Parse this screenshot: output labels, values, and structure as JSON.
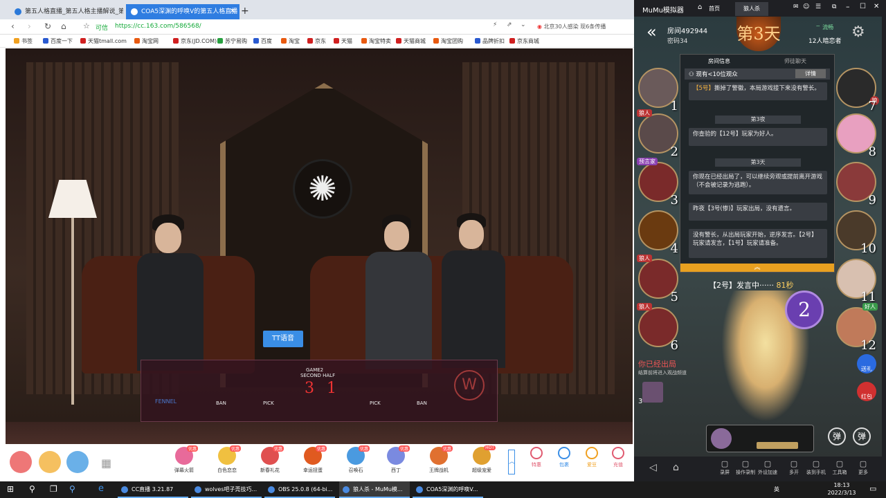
{
  "browser": {
    "tabs": [
      {
        "label": "第五人格直播_第五人格主播解说_第三"
      },
      {
        "label": "COA5深渊的呼唤V的第五人格直播"
      }
    ],
    "address": {
      "label": "可信",
      "url": "https://cc.163.com/586568/"
    },
    "search": "北京30人感染 现6条传播",
    "bookmarks": [
      "书签",
      "百度一下",
      "天猫tmall.com",
      "淘宝网",
      "京东(JD.COM)",
      "苏宁易购",
      "百度",
      "淘宝",
      "京东",
      "天猫",
      "淘宝特卖",
      "天猫商城",
      "淘宝团购",
      "品牌折扣",
      "京东商城"
    ]
  },
  "video": {
    "scoreboard": {
      "game": "GAME2",
      "half": "SECOND HALF",
      "score_left": "3",
      "score_right": "1",
      "ban_left": "BAN",
      "pick_left": "PICK",
      "pick_right": "PICK",
      "ban_right": "BAN",
      "team_left": "FENNEL"
    },
    "sponsor": "TT语音"
  },
  "giftbar": {
    "gifts": [
      {
        "label": "弹幕火箭",
        "badge": "优惠"
      },
      {
        "label": "白色恋恋",
        "badge": "优惠"
      },
      {
        "label": "新春礼花",
        "badge": "优惠"
      },
      {
        "label": "幸运扭蛋",
        "badge": "优惠"
      },
      {
        "label": "召唤石",
        "badge": "优惠"
      },
      {
        "label": "西丁",
        "badge": "优惠"
      },
      {
        "label": "王牌战机",
        "badge": "优惠"
      },
      {
        "label": "超级宠爱",
        "badge": "HOT"
      }
    ],
    "right": [
      "特惠",
      "包裹",
      "爱豆",
      "充值"
    ]
  },
  "emulator": {
    "title": "MuMu模拟器",
    "tabs": [
      "首页",
      "狼人杀"
    ],
    "room_label": "房间492944",
    "password_label": "密码34",
    "day_label": "第3天",
    "network": "流畅",
    "spectators": "12人暗恋者",
    "chat_tabs": [
      "房间信息",
      "师徒聊天"
    ],
    "audience": "现有<10位观众",
    "detail_btn": "详情",
    "messages": [
      {
        "pre": "【5号】",
        "text": "撕掉了警徽，本局游戏接下来没有警长。"
      },
      {
        "text": "你查验的【12号】玩家为好人。"
      },
      {
        "text": "你现在已经出局了，可以继续旁观或提前离开游戏（不会被记录为逃跑）。"
      },
      {
        "text": "昨夜【3号(惨)】玩家出局，没有遗言。"
      },
      {
        "text": "没有警长，从出局玩家开始，逆序发言。【2号】玩家请发言，【1号】玩家请准备。"
      }
    ],
    "night3": "第3夜",
    "day3": "第3天",
    "speaking": "【2号】发言中······",
    "speaking_time": "81秒",
    "out_text": "你已经出局",
    "out_sub": "结算前将进入观战频道",
    "seats_left": [
      {
        "num": "1",
        "role": ""
      },
      {
        "num": "2",
        "role": "狼人"
      },
      {
        "num": "3",
        "role": "预言家"
      },
      {
        "num": "4",
        "role": ""
      },
      {
        "num": "5",
        "role": "狼人"
      },
      {
        "num": "6",
        "role": "狼人"
      }
    ],
    "seats_right": [
      {
        "num": "7",
        "role": "狼"
      },
      {
        "num": "8",
        "role": ""
      },
      {
        "num": "9",
        "role": ""
      },
      {
        "num": "10",
        "role": ""
      },
      {
        "num": "11",
        "role": ""
      },
      {
        "num": "12",
        "role": "好人"
      }
    ],
    "big_num": "2",
    "side_btns": [
      "送礼",
      "红包"
    ],
    "danmu": "弹",
    "nav": [
      "录屏",
      "操作录制",
      "外设加速",
      "多开",
      "装到手机",
      "工具箱",
      "更多"
    ]
  },
  "taskbar": {
    "apps": [
      "CC直播 3.21.87",
      "wolves吧子莞技巧...",
      "OBS 25.0.8 (64-bi...",
      "狼人杀 - MuMu模...",
      "COA5深渊的呼唤V..."
    ],
    "time": "18:13",
    "date": "2022/3/13",
    "ime": "英"
  }
}
